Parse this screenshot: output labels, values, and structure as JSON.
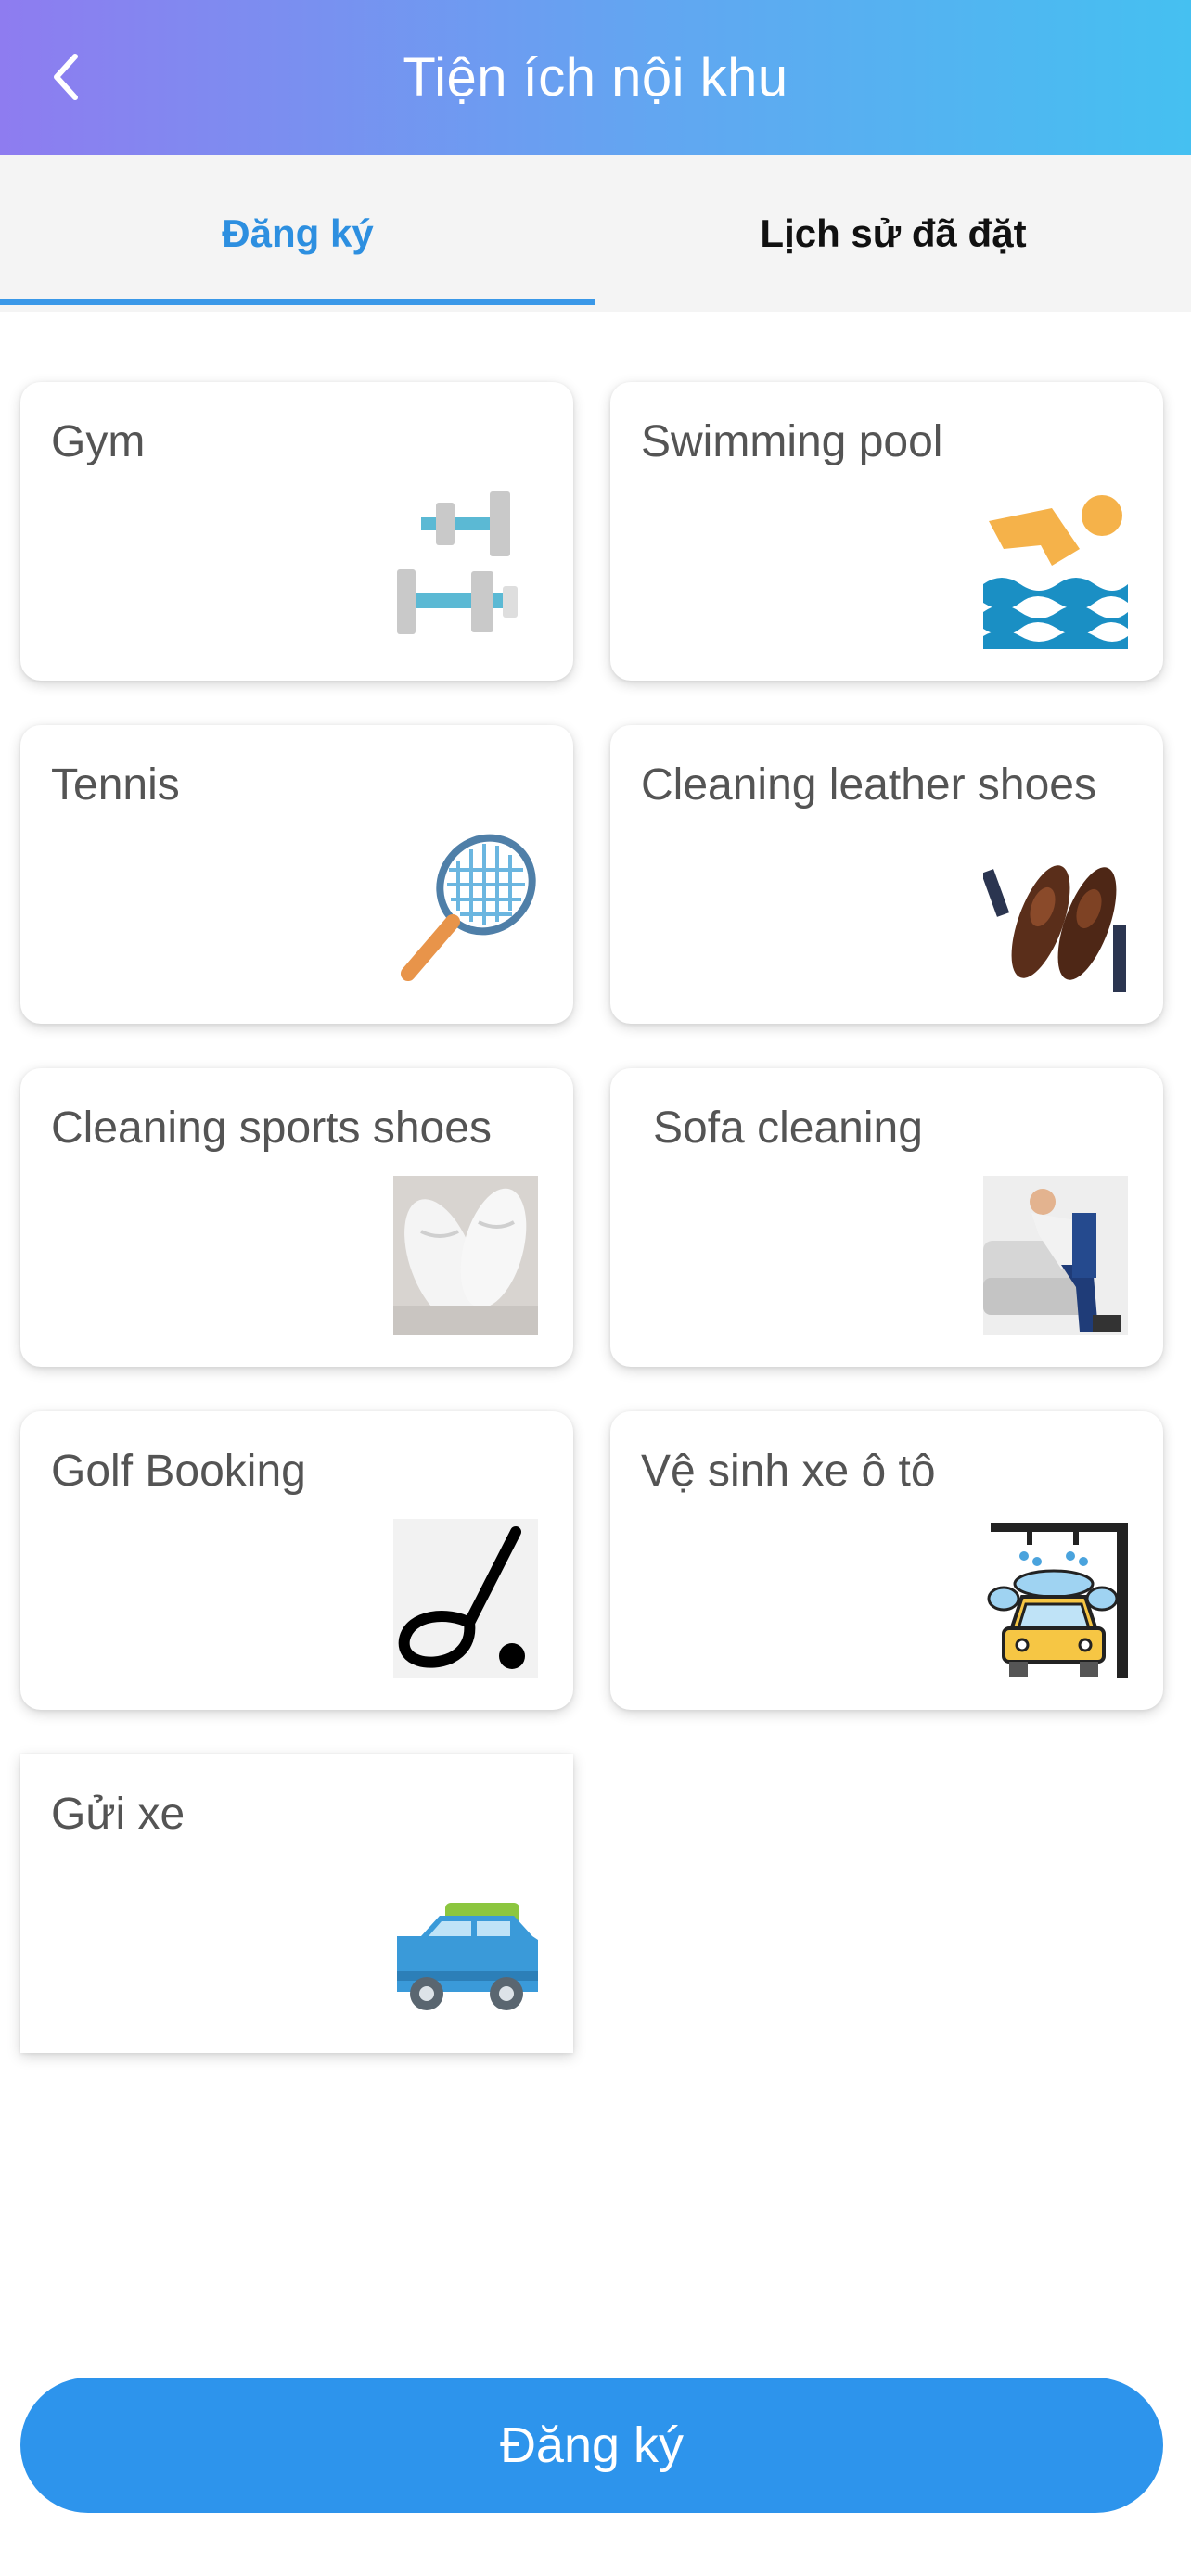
{
  "header": {
    "title": "Tiện ích nội khu",
    "back_icon": "chevron-left-icon"
  },
  "tabs": [
    {
      "label": "Đăng ký",
      "active": true
    },
    {
      "label": "Lịch sử đã đặt",
      "active": false
    }
  ],
  "services": [
    {
      "title": "Gym",
      "icon": "dumbbell-icon"
    },
    {
      "title": "Swimming pool",
      "icon": "swimmer-icon"
    },
    {
      "title": "Tennis",
      "icon": "tennis-racket-icon"
    },
    {
      "title": "Cleaning leather shoes",
      "icon": "leather-shoes-icon"
    },
    {
      "title": "Cleaning sports shoes",
      "icon": "sneakers-photo"
    },
    {
      "title": "Sofa cleaning",
      "icon": "sofa-cleaning-photo"
    },
    {
      "title": "Golf Booking",
      "icon": "golf-club-icon"
    },
    {
      "title": "Vệ sinh xe ô tô",
      "icon": "car-wash-icon"
    },
    {
      "title": "Gửi xe",
      "icon": "parking-van-icon"
    }
  ],
  "submit_button": {
    "label": "Đăng ký"
  },
  "colors": {
    "accent": "#2d94ec",
    "header_start": "#8e7cf0",
    "header_end": "#45c0f1",
    "card_text": "#545454"
  }
}
